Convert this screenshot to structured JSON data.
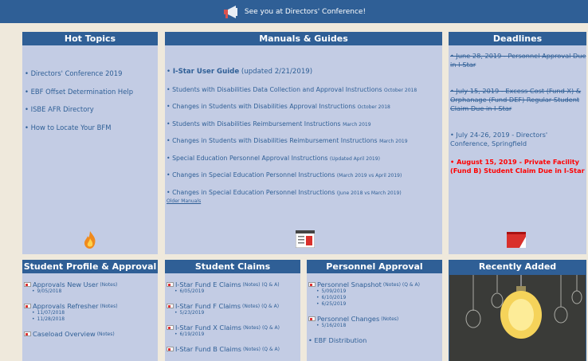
{
  "banner": {
    "text": "See you at Directors' Conference!"
  },
  "hot_topics": {
    "title": "Hot Topics",
    "items": [
      "Directors' Conference 2019",
      "EBF Offset Determination Help",
      "ISBE AFR Directory",
      "How to Locate Your BFM"
    ]
  },
  "manuals": {
    "title": "Manuals & Guides",
    "first": {
      "link": "I-Star User Guide",
      "note": "(updated 2/21/2019)"
    },
    "items": [
      {
        "text": "Students with Disabilities Data Collection and Approval Instructions",
        "note": "October 2018"
      },
      {
        "text": "Changes in Students with Disabilities Approval Instructions",
        "note": "October 2018"
      },
      {
        "text": "Students with Disabilities Reimbursement Instructions",
        "note": "March 2019"
      },
      {
        "text": "Changes in Students with Disabilities Reimbursement Instructions",
        "note": "March 2019"
      },
      {
        "text": "Special Education Personnel Approval Instructions",
        "note": "(Updated April 2019)"
      },
      {
        "text": "Changes in Special Education Personnel Instructions",
        "note": "(March 2019 vs April 2019)"
      },
      {
        "text": "Changes in Special Education Personnel Instructions",
        "note": "(June 2018 vs March 2019)"
      }
    ],
    "older": "Older Manuals"
  },
  "deadlines": {
    "title": "Deadlines",
    "items": [
      "• June 28, 2019 - Personnel Approval Due in I-Star",
      "• July 15, 2019 - Excess Cost (Fund X) & Orphanage (Fund DEF) Regular Student Claim Due in I-Star",
      "• July 24-26, 2019 - Directors' Conference, Springfield",
      "• August 15, 2019 - Private Facility (Fund B) Student Claim Due in I-Star"
    ]
  },
  "student": {
    "title": "Student Profile & Approval",
    "entries": [
      {
        "title": "Approvals New User",
        "notes": "(Notes)",
        "dates": [
          "9/05/2018"
        ]
      },
      {
        "title": "Approvals Refresher",
        "notes": "(Notes)",
        "dates": [
          "11/07/2018",
          "11/28/2018"
        ]
      },
      {
        "title": "Caseload Overview",
        "notes": "(Notes)",
        "dates": []
      }
    ]
  },
  "claims": {
    "title": "Student Claims",
    "qa": "(Q & A)",
    "entries": [
      {
        "title": "I-Star Fund E Claims",
        "notes": "(Notes)",
        "dates": [
          "6/05/2019"
        ]
      },
      {
        "title": "I-Star Fund F Claims",
        "notes": "(Notes)",
        "dates": [
          "5/23/2019"
        ]
      },
      {
        "title": "I-Star Fund X Claims",
        "notes": "(Notes)",
        "dates": [
          "6/19/2019"
        ]
      },
      {
        "title": "I-Star Fund B Claims",
        "notes": "(Notes)",
        "dates": []
      }
    ]
  },
  "personnel": {
    "title": "Personnel Approval",
    "entries": [
      {
        "title": "Personnel Snapshot",
        "notes": "(Notes)",
        "qa": "(Q & A)",
        "dates": [
          "5/09/2019",
          "6/10/2019",
          "6/25/2019"
        ]
      },
      {
        "title": "Personnel Changes",
        "notes": "(Notes)",
        "dates": [
          "5/16/2018"
        ]
      }
    ],
    "ebf": "• EBF Distribution"
  },
  "recent": {
    "title": "Recently Added"
  },
  "colors": {
    "header": "#2f5f96",
    "panel": "#c3cce4",
    "alert": "#ff0000"
  }
}
